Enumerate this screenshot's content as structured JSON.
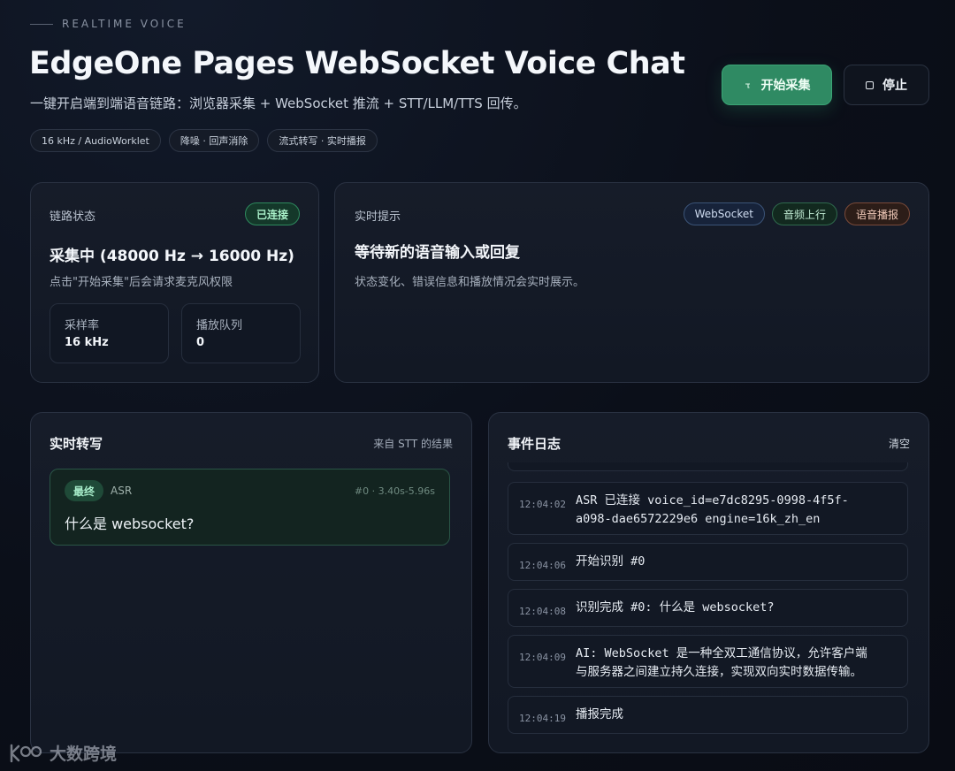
{
  "header": {
    "eyebrow": "REALTIME VOICE",
    "title": "EdgeOne Pages WebSocket Voice Chat",
    "subtitle": "一键开启端到端语音链路：浏览器采集 + WebSocket 推流 + STT/LLM/TTS 回传。",
    "chips": [
      "16 kHz / AudioWorklet",
      "降噪 · 回声消除",
      "流式转写 · 实时播报"
    ],
    "start_label": "开始采集",
    "stop_label": "停止"
  },
  "link_status": {
    "label": "链路状态",
    "badge": "已连接",
    "headline": "采集中 (48000 Hz → 16000 Hz)",
    "hint": "点击\"开始采集\"后会请求麦克风权限",
    "stats": [
      {
        "key": "采样率",
        "value": "16 kHz"
      },
      {
        "key": "播放队列",
        "value": "0"
      }
    ]
  },
  "realtime_tips": {
    "label": "实时提示",
    "pills": [
      "WebSocket",
      "音频上行",
      "语音播报"
    ],
    "headline": "等待新的语音输入或回复",
    "desc": "状态变化、错误信息和播放情况会实时展示。"
  },
  "transcript": {
    "title": "实时转写",
    "source": "来自 STT 的结果",
    "items": [
      {
        "tag": "最终",
        "engine": "ASR",
        "meta": "#0 · 3.40s-5.96s",
        "text": "什么是 websocket?"
      }
    ]
  },
  "event_log": {
    "title": "事件日志",
    "clear_label": "清空",
    "entries": [
      {
        "time": "12:04:02",
        "lines": [
          "ASR 已连接 voice_id=e7dc8295-0998-4f5f-",
          "a098-dae6572229e6 engine=16k_zh_en"
        ]
      },
      {
        "time": "12:04:06",
        "lines": [
          "开始识别 #0"
        ]
      },
      {
        "time": "12:04:08",
        "lines": [
          "识别完成 #0: 什么是 websocket?"
        ]
      },
      {
        "time": "12:04:09",
        "lines": [
          "AI: WebSocket 是一种全双工通信协议，允许客户端",
          "与服务器之间建立持久连接，实现双向实时数据传输。"
        ]
      },
      {
        "time": "12:04:19",
        "lines": [
          "播报完成"
        ]
      }
    ]
  },
  "watermark": "大数跨境"
}
